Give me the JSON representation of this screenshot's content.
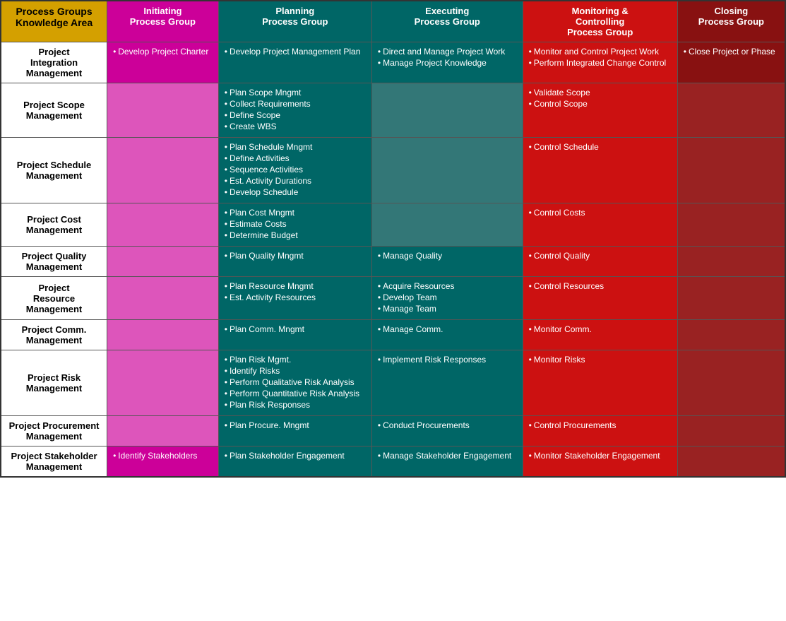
{
  "header": {
    "col1": "Process Groups\nKnowledge Area",
    "col2": "Initiating\nProcess Group",
    "col3": "Planning\nProcess Group",
    "col4": "Executing\nProcess Group",
    "col5": "Monitoring &\nControlling\nProcess Group",
    "col6": "Closing\nProcess Group"
  },
  "rows": [
    {
      "knowledge": "Project\nIntegration\nManagement",
      "initiating": [
        "Develop Project Charter"
      ],
      "planning": [
        "Develop Project Management Plan"
      ],
      "executing": [
        "Direct and Manage Project Work",
        "Manage Project Knowledge"
      ],
      "monitoring": [
        "Monitor and Control Project Work",
        "Perform Integrated Change Control"
      ],
      "closing": [
        "Close Project or Phase"
      ]
    },
    {
      "knowledge": "Project Scope\nManagement",
      "initiating": [],
      "planning": [
        "Plan Scope Mngmt",
        "Collect Requirements",
        "Define Scope",
        "Create WBS"
      ],
      "executing": [],
      "monitoring": [
        "Validate Scope",
        "Control Scope"
      ],
      "closing": []
    },
    {
      "knowledge": "Project Schedule\nManagement",
      "initiating": [],
      "planning": [
        "Plan Schedule Mngmt",
        "Define Activities",
        "Sequence Activities",
        "Est. Activity Durations",
        "Develop Schedule"
      ],
      "executing": [],
      "monitoring": [
        "Control Schedule"
      ],
      "closing": []
    },
    {
      "knowledge": "Project  Cost\nManagement",
      "initiating": [],
      "planning": [
        "Plan Cost Mngmt",
        "Estimate Costs",
        "Determine Budget"
      ],
      "executing": [],
      "monitoring": [
        "Control Costs"
      ],
      "closing": []
    },
    {
      "knowledge": "Project Quality\nManagement",
      "initiating": [],
      "planning": [
        "Plan Quality Mngmt"
      ],
      "executing": [
        "Manage Quality"
      ],
      "monitoring": [
        "Control Quality"
      ],
      "closing": []
    },
    {
      "knowledge": "Project\nResource\nManagement",
      "initiating": [],
      "planning": [
        "Plan Resource Mngmt",
        "Est. Activity Resources"
      ],
      "executing": [
        "Acquire Resources",
        "Develop Team",
        "Manage Team"
      ],
      "monitoring": [
        "Control Resources"
      ],
      "closing": []
    },
    {
      "knowledge": "Project Comm.\nManagement",
      "initiating": [],
      "planning": [
        "Plan Comm. Mngmt"
      ],
      "executing": [
        "Manage Comm."
      ],
      "monitoring": [
        "Monitor Comm."
      ],
      "closing": []
    },
    {
      "knowledge": "Project  Risk\nManagement",
      "initiating": [],
      "planning": [
        "Plan Risk Mgmt.",
        "Identify Risks",
        "Perform Qualitative Risk Analysis",
        "Perform Quantitative Risk Analysis",
        "Plan Risk Responses"
      ],
      "executing": [
        "Implement Risk Responses"
      ],
      "monitoring": [
        "Monitor Risks"
      ],
      "closing": []
    },
    {
      "knowledge": "Project Procurement\nManagement",
      "initiating": [],
      "planning": [
        "Plan Procure. Mngmt"
      ],
      "executing": [
        "Conduct Procurements"
      ],
      "monitoring": [
        "Control Procurements"
      ],
      "closing": []
    },
    {
      "knowledge": "Project Stakeholder\nManagement",
      "initiating": [
        "Identify Stakeholders"
      ],
      "planning": [
        "Plan Stakeholder Engagement"
      ],
      "executing": [
        "Manage Stakeholder Engagement"
      ],
      "monitoring": [
        "Monitor Stakeholder Engagement"
      ],
      "closing": []
    }
  ]
}
